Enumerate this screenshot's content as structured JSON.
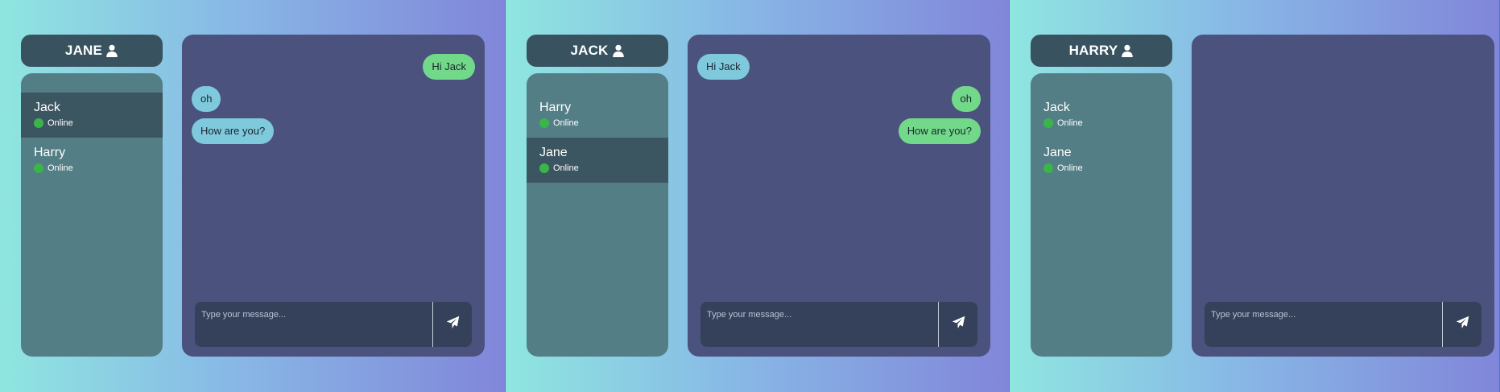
{
  "composer_placeholder": "Type your message...",
  "status_color": "#3ab54a",
  "send_icon": "paper-plane-icon",
  "user_icon": "user-icon",
  "panes": [
    {
      "user": "JANE",
      "contacts": [
        {
          "name": "Jack",
          "status": "Online",
          "active": true
        },
        {
          "name": "Harry",
          "status": "Online",
          "active": false
        }
      ],
      "messages": [
        {
          "text": "Hi Jack",
          "direction": "out"
        },
        {
          "text": "oh",
          "direction": "in"
        },
        {
          "text": "How are you?",
          "direction": "in"
        }
      ]
    },
    {
      "user": "JACK",
      "contacts": [
        {
          "name": "Harry",
          "status": "Online",
          "active": false
        },
        {
          "name": "Jane",
          "status": "Online",
          "active": true
        }
      ],
      "messages": [
        {
          "text": "Hi Jack",
          "direction": "in"
        },
        {
          "text": "oh",
          "direction": "out"
        },
        {
          "text": "How are you?",
          "direction": "out"
        }
      ]
    },
    {
      "user": "HARRY",
      "contacts": [
        {
          "name": "Jack",
          "status": "Online",
          "active": false
        },
        {
          "name": "Jane",
          "status": "Online",
          "active": false
        }
      ],
      "messages": []
    }
  ]
}
